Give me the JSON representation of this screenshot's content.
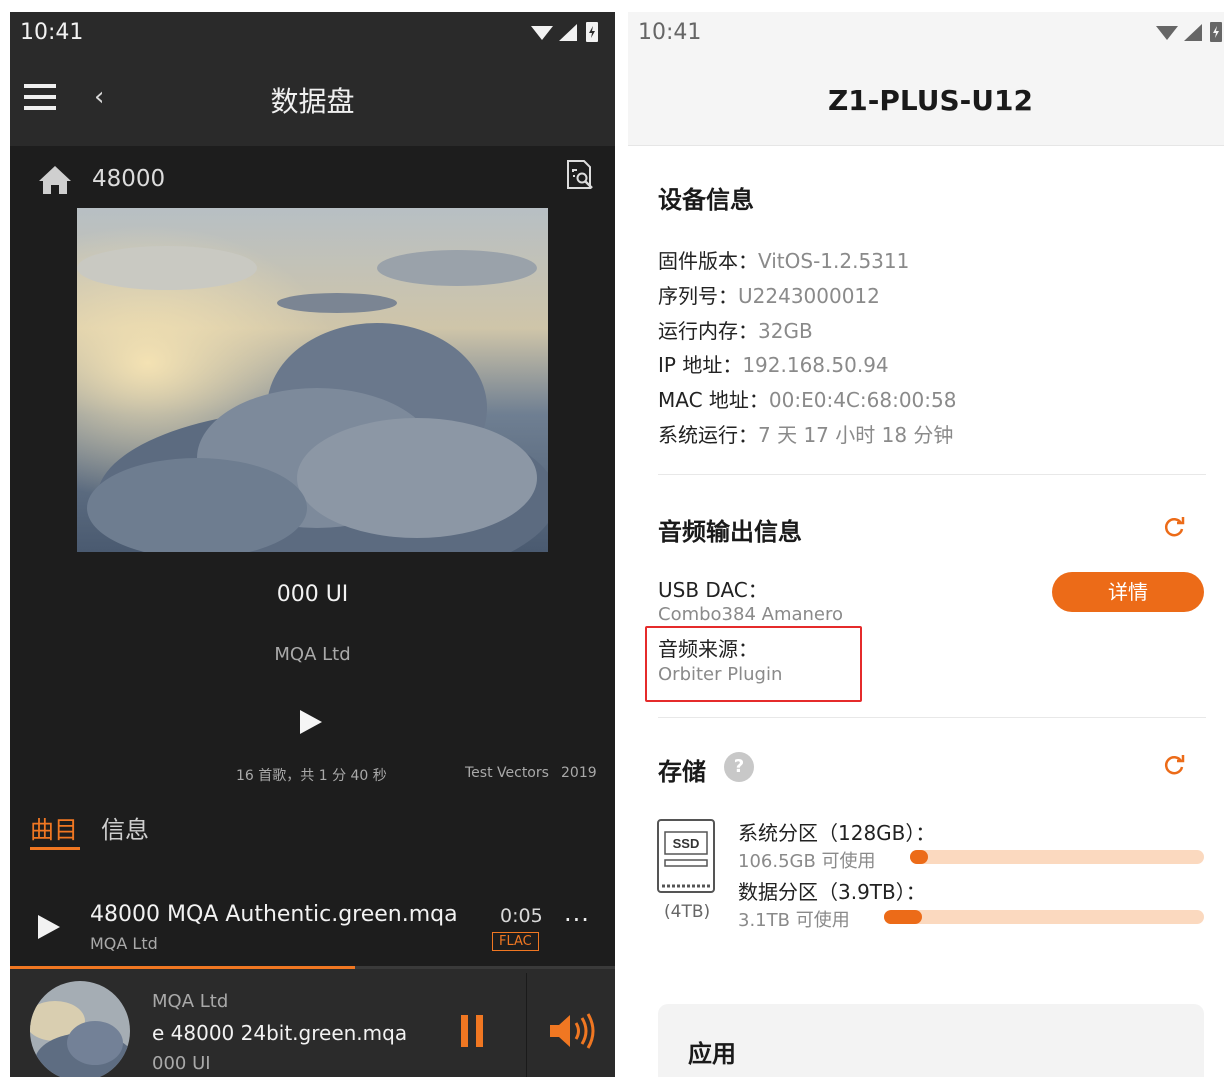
{
  "left_screen": {
    "status_bar": {
      "time": "10:41"
    },
    "app_bar": {
      "title": "数据盘"
    },
    "folder": {
      "name": "48000"
    },
    "album": {
      "title": "000 UI",
      "artist": "MQA Ltd",
      "summary": "16 首歌，共 1 分 40 秒",
      "label": "Test Vectors",
      "year": "2019"
    },
    "tabs": [
      {
        "label": "曲目"
      },
      {
        "label": "信息"
      }
    ],
    "track": {
      "name": "48000 MQA Authentic.green.mqa",
      "artist": "MQA Ltd",
      "duration": "0:05",
      "format": "FLAC",
      "more": "···"
    },
    "progress_fraction": 0.57,
    "now_playing": {
      "artist": "MQA Ltd",
      "track": "e 48000 24bit.green.mqa",
      "album": "000 UI"
    },
    "accent_color": "#f07722"
  },
  "right_screen": {
    "status_bar": {
      "time": "10:41"
    },
    "app_bar": {
      "title": "Z1-PLUS-U12"
    },
    "device_info": {
      "title": "设备信息",
      "rows": [
        {
          "label": "固件版本：",
          "value": "VitOS-1.2.5311"
        },
        {
          "label": "序列号：",
          "value": "U2243000012"
        },
        {
          "label": "运行内存：",
          "value": "32GB"
        },
        {
          "label": "IP 地址：",
          "value": "192.168.50.94"
        },
        {
          "label": "MAC 地址：",
          "value": "00:E0:4C:68:00:58"
        },
        {
          "label": "系统运行：",
          "value": "7 天 17 小时 18 分钟"
        }
      ]
    },
    "audio_output": {
      "title": "音频输出信息",
      "usb_dac_label": "USB DAC：",
      "usb_dac_value": "Combo384 Amanero",
      "detail_button": "详情",
      "source_label": "音频来源：",
      "source_value": "Orbiter Plugin"
    },
    "storage": {
      "title": "存储",
      "help": "?",
      "ssd_badge": "SSD",
      "capacity": "(4TB)",
      "partitions": [
        {
          "title": "系统分区（128GB）：",
          "free": "106.5GB 可使用",
          "used_fraction": 0.05
        },
        {
          "title": "数据分区（3.9TB）：",
          "free": "3.1TB 可使用",
          "used_fraction": 0.12
        }
      ]
    },
    "apps": {
      "title": "应用"
    },
    "accent_color": "#ec6b18"
  }
}
